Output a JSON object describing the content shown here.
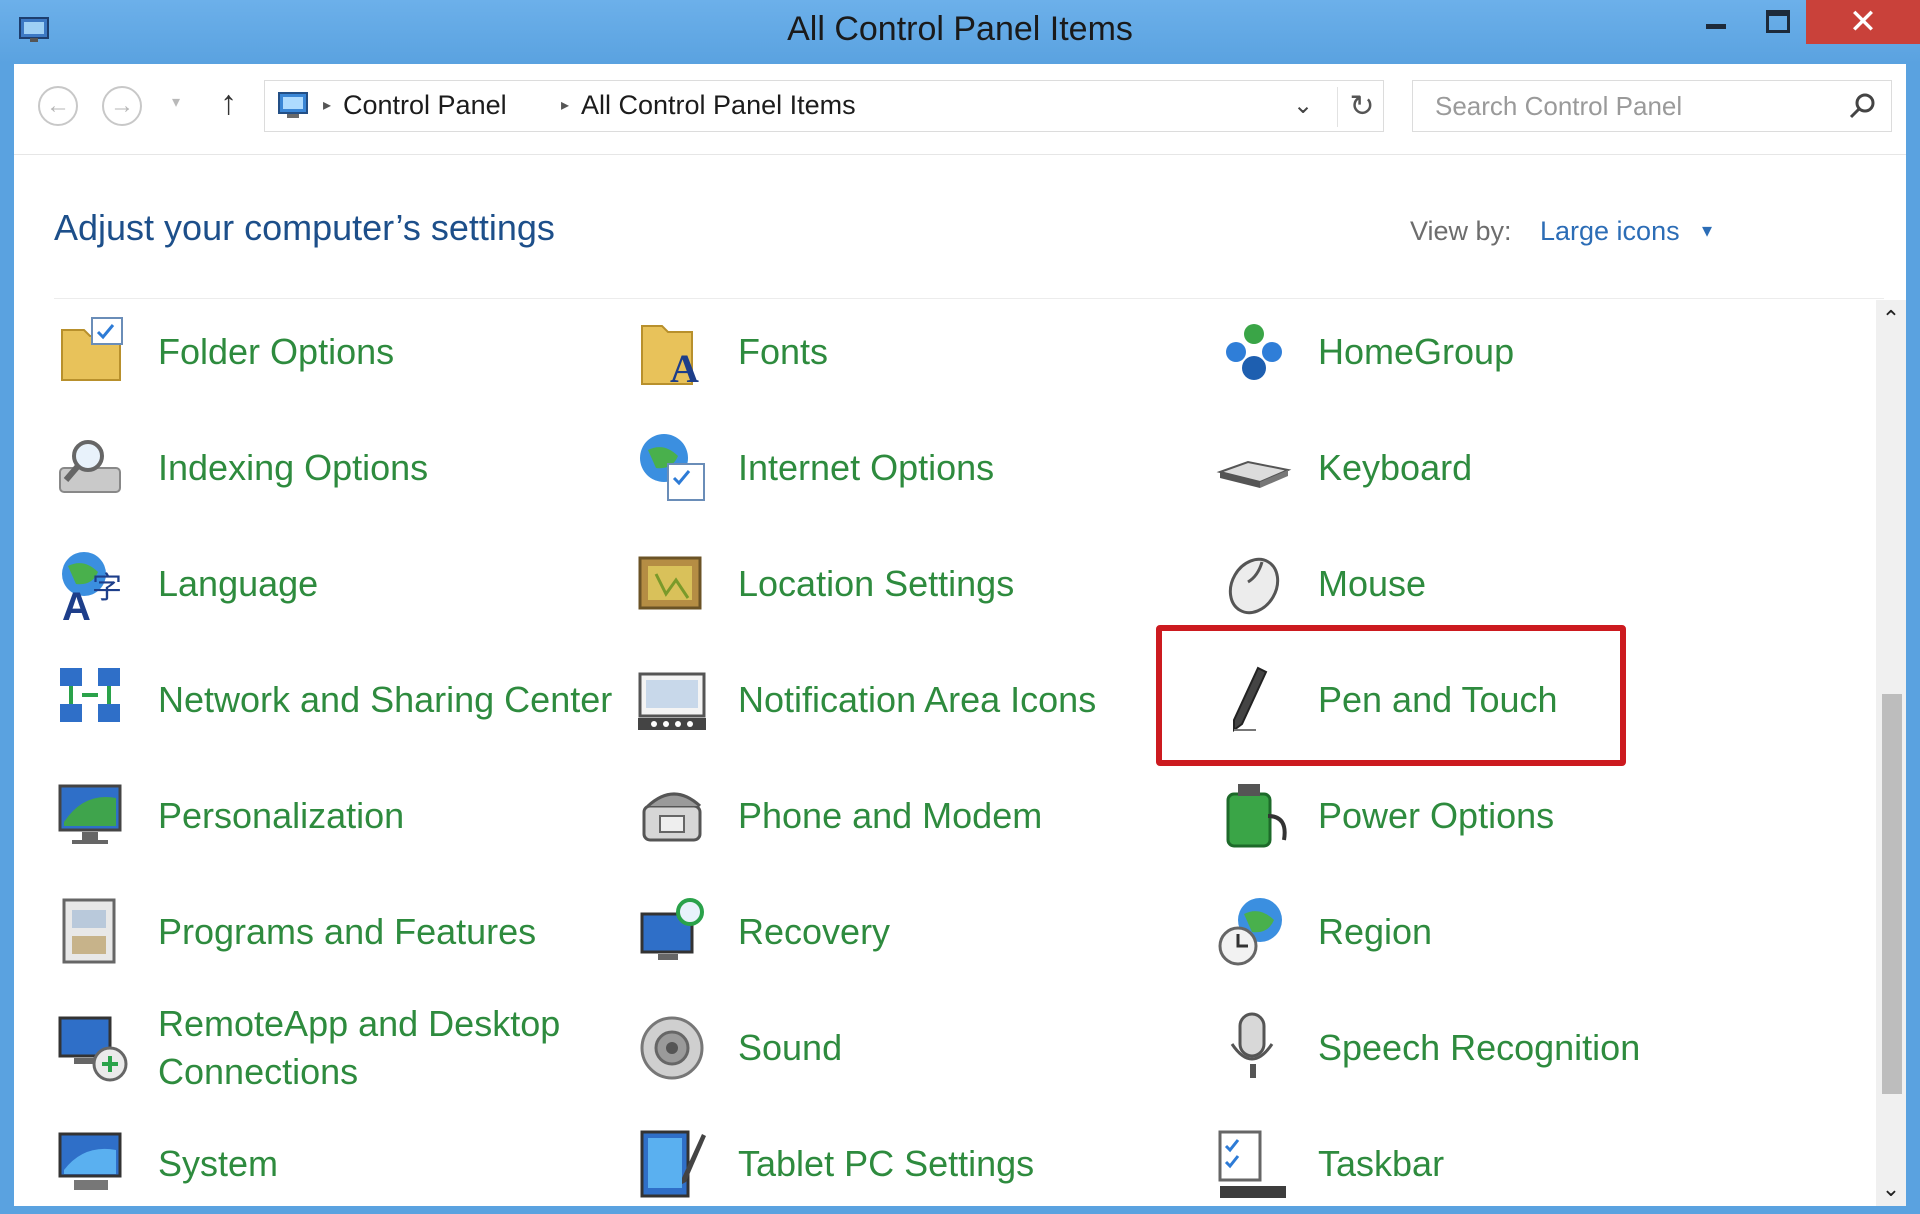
{
  "window": {
    "title": "All Control Panel Items",
    "close_glyph": "✕"
  },
  "nav": {
    "back_glyph": "←",
    "forward_glyph": "→",
    "recent_glyph": "▾",
    "up_glyph": "↑",
    "breadcrumb": [
      "Control Panel",
      "All Control Panel Items"
    ],
    "separator_glyph": "▸",
    "dropdown_glyph": "⌄",
    "refresh_glyph": "↻"
  },
  "search": {
    "placeholder": "Search Control Panel"
  },
  "header": {
    "title": "Adjust your computer’s settings",
    "view_by_label": "View by:",
    "view_by_value": "Large icons",
    "view_by_caret": "▾"
  },
  "items": [
    {
      "label": "Folder Options",
      "icon": "folder-options-icon"
    },
    {
      "label": "Fonts",
      "icon": "fonts-icon"
    },
    {
      "label": "HomeGroup",
      "icon": "homegroup-icon"
    },
    {
      "label": "Indexing Options",
      "icon": "indexing-options-icon"
    },
    {
      "label": "Internet Options",
      "icon": "internet-options-icon"
    },
    {
      "label": "Keyboard",
      "icon": "keyboard-icon"
    },
    {
      "label": "Language",
      "icon": "language-icon"
    },
    {
      "label": "Location Settings",
      "icon": "location-settings-icon"
    },
    {
      "label": "Mouse",
      "icon": "mouse-icon"
    },
    {
      "label": "Network and Sharing Center",
      "icon": "network-icon"
    },
    {
      "label": "Notification Area Icons",
      "icon": "notification-area-icon"
    },
    {
      "label": "Pen and Touch",
      "icon": "pen-icon"
    },
    {
      "label": "Personalization",
      "icon": "personalization-icon"
    },
    {
      "label": "Phone and Modem",
      "icon": "phone-icon"
    },
    {
      "label": "Power Options",
      "icon": "power-options-icon"
    },
    {
      "label": "Programs and Features",
      "icon": "programs-icon"
    },
    {
      "label": "Recovery",
      "icon": "recovery-icon"
    },
    {
      "label": "Region",
      "icon": "region-icon"
    },
    {
      "label": "RemoteApp and Desktop Connections",
      "icon": "remoteapp-icon"
    },
    {
      "label": "Sound",
      "icon": "sound-icon"
    },
    {
      "label": "Speech Recognition",
      "icon": "microphone-icon"
    },
    {
      "label": "System",
      "icon": "system-icon"
    },
    {
      "label": "Tablet PC Settings",
      "icon": "tablet-icon"
    },
    {
      "label": "Taskbar",
      "icon": "taskbar-icon"
    }
  ],
  "highlighted_item": "Pen and Touch",
  "scrollbar": {
    "up_glyph": "⌃",
    "down_glyph": "⌄"
  },
  "colors": {
    "title_bar": "#5aa2e0",
    "close_button": "#c9413a",
    "item_link": "#2e8b3e",
    "heading": "#1d4f8a",
    "view_by_value": "#2c6db6",
    "highlight_border": "#cc1a1f"
  }
}
